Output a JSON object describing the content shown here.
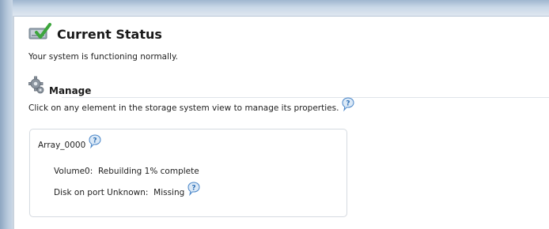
{
  "current_status": {
    "title": "Current Status",
    "message": "Your system is functioning normally.",
    "icon": "status-ok-icon"
  },
  "manage": {
    "title": "Manage",
    "icon": "gear-icon",
    "instruction": "Click on any element in the storage system view to manage its properties."
  },
  "storage": {
    "array_name": "Array_0000",
    "volume_label": "Volume0:",
    "volume_status": "Rebuilding 1% complete",
    "disk_label": "Disk on port Unknown:",
    "disk_status": "Missing"
  },
  "colors": {
    "check_green": "#3da63d",
    "help_blue": "#4a86c8",
    "card_border": "#d6dbe1"
  }
}
